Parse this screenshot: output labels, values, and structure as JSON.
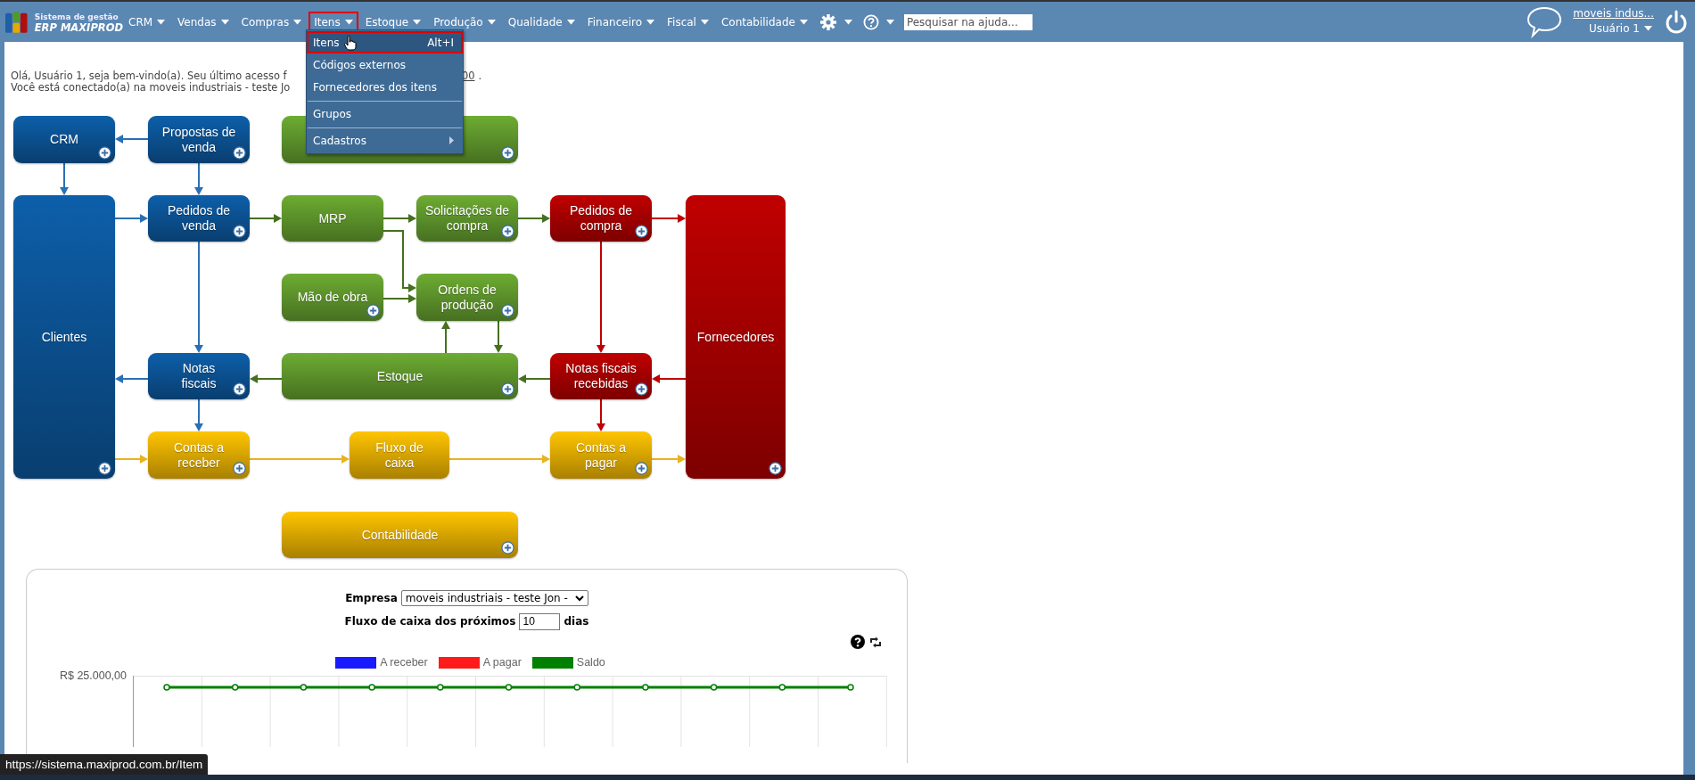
{
  "header": {
    "logo_line1": "Sistema de gestão",
    "logo_line2": "ERP MAXIPROD",
    "menu": [
      {
        "label": "CRM",
        "selected": false
      },
      {
        "label": "Vendas",
        "selected": false
      },
      {
        "label": "Compras",
        "selected": false
      },
      {
        "label": "Itens",
        "selected": true
      },
      {
        "label": "Estoque",
        "selected": false
      },
      {
        "label": "Produção",
        "selected": false
      },
      {
        "label": "Qualidade",
        "selected": false
      },
      {
        "label": "Financeiro",
        "selected": false
      },
      {
        "label": "Fiscal",
        "selected": false
      },
      {
        "label": "Contabilidade",
        "selected": false
      }
    ],
    "search": {
      "placeholder": "Pesquisar na ajuda..."
    },
    "company_link": "moveis indus...",
    "user": "Usuário 1"
  },
  "items_menu": {
    "entries": [
      {
        "label": "Itens",
        "shortcut": "Alt+I",
        "selected": true,
        "divider_before": false,
        "has_submenu": false
      },
      {
        "label": "Códigos externos",
        "selected": false,
        "divider_before": false,
        "has_submenu": false
      },
      {
        "label": "Fornecedores dos itens",
        "selected": false,
        "divider_before": false,
        "has_submenu": false
      },
      {
        "label": "Grupos",
        "selected": false,
        "divider_before": true,
        "has_submenu": false
      },
      {
        "label": "Cadastros",
        "selected": false,
        "divider_before": true,
        "has_submenu": true
      }
    ]
  },
  "greeting": {
    "line1": "Olá, Usuário 1, seja bem-vindo(a). Seu último acesso f",
    "line1_link": "00",
    "line1_end": ".",
    "line2": "Você está conectado(a) na moveis industriais - teste Jo"
  },
  "flow_diagram": {
    "nodes": [
      {
        "label": "CRM",
        "color": "#0b4f8e",
        "has_plus": true
      },
      {
        "label": "Propostas de\nvenda",
        "color": "#0b4f8e",
        "has_plus": true
      },
      {
        "color": "#5b8f2a",
        "has_plus": true
      },
      {
        "label": "Clientes",
        "color": "#0b4f8e",
        "has_plus": true
      },
      {
        "label": "Pedidos de\nvenda",
        "color": "#0b4f8e",
        "has_plus": true
      },
      {
        "label": "MRP",
        "color": "#5b8f2a",
        "has_plus": false
      },
      {
        "label": "Solicitações de\ncompra",
        "color": "#5b8f2a",
        "has_plus": true
      },
      {
        "label": "Pedidos de\ncompra",
        "color": "#a00000",
        "has_plus": true
      },
      {
        "label": "Fornecedores",
        "color": "#a00000",
        "has_plus": true
      },
      {
        "label": "Mão de obra",
        "color": "#5b8f2a",
        "has_plus": true
      },
      {
        "label": "Ordens de\nprodução",
        "color": "#5b8f2a",
        "has_plus": true
      },
      {
        "label": "Notas\nfiscais",
        "color": "#0b4f8e",
        "has_plus": true
      },
      {
        "label": "Estoque",
        "color": "#5b8f2a",
        "has_plus": true
      },
      {
        "label": "Notas fiscais\nrecebidas",
        "color": "#a00000",
        "has_plus": true
      },
      {
        "label": "Contas a\nreceber",
        "color": "#d9a400",
        "has_plus": true
      },
      {
        "label": "Fluxo de\ncaixa",
        "color": "#d9a400",
        "has_plus": false
      },
      {
        "label": "Contas a\npagar",
        "color": "#d9a400",
        "has_plus": true
      },
      {
        "label": "Contabilidade",
        "color": "#d9a400",
        "has_plus": true
      }
    ]
  },
  "cash_flow": {
    "company_label": "Empresa",
    "company_value": "moveis industriais - teste Jon -",
    "days_label": "Fluxo de caixa dos próximos",
    "days_value": "10",
    "days_unit": "dias",
    "legend": [
      {
        "label": "A receber",
        "color": "#1a1aff"
      },
      {
        "label": "A pagar",
        "color": "#ff1a1a"
      },
      {
        "label": "Saldo",
        "color": "#008000"
      }
    ],
    "y_tick": "R$ 25.000,00"
  },
  "status_url": "https://sistema.maxiprod.com.br/Item"
}
